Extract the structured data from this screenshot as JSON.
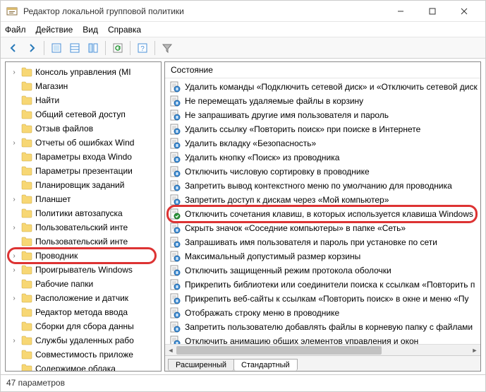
{
  "window": {
    "title": "Редактор локальной групповой политики"
  },
  "menu": {
    "file": "Файл",
    "action": "Действие",
    "view": "Вид",
    "help": "Справка"
  },
  "tree": {
    "items": [
      {
        "label": "Консоль управления (MI",
        "exp": "›"
      },
      {
        "label": "Магазин",
        "exp": ""
      },
      {
        "label": "Найти",
        "exp": ""
      },
      {
        "label": "Общий сетевой доступ",
        "exp": ""
      },
      {
        "label": "Отзыв файлов",
        "exp": ""
      },
      {
        "label": "Отчеты об ошибках Wind",
        "exp": "›"
      },
      {
        "label": "Параметры входа Windo",
        "exp": ""
      },
      {
        "label": "Параметры презентации",
        "exp": ""
      },
      {
        "label": "Планировщик заданий",
        "exp": ""
      },
      {
        "label": "Планшет",
        "exp": "›"
      },
      {
        "label": "Политики автозапуска",
        "exp": ""
      },
      {
        "label": "Пользовательский инте",
        "exp": "›"
      },
      {
        "label": "Пользовательский инте",
        "exp": ""
      },
      {
        "label": "Проводник",
        "exp": "›",
        "hl": true
      },
      {
        "label": "Проигрыватель Windows",
        "exp": "›"
      },
      {
        "label": "Рабочие папки",
        "exp": ""
      },
      {
        "label": "Расположение и датчик",
        "exp": "›"
      },
      {
        "label": "Редактор метода ввода",
        "exp": ""
      },
      {
        "label": "Сборки для сбора данны",
        "exp": ""
      },
      {
        "label": "Службы удаленных рабо",
        "exp": "›"
      },
      {
        "label": "Совместимость приложе",
        "exp": ""
      },
      {
        "label": "Содержимое облака",
        "exp": ""
      }
    ]
  },
  "list": {
    "header": "Состояние",
    "items": [
      {
        "label": "Удалить команды «Подключить сетевой диск» и «Отключить сетевой диск"
      },
      {
        "label": "Не перемещать удаляемые файлы в корзину"
      },
      {
        "label": "Не запрашивать другие имя пользователя и пароль"
      },
      {
        "label": "Удалить ссылку «Повторить поиск» при поиске в Интернете"
      },
      {
        "label": "Удалить вкладку «Безопасность»"
      },
      {
        "label": "Удалить кнопку «Поиск» из проводника"
      },
      {
        "label": "Отключить числовую сортировку в проводнике"
      },
      {
        "label": "Запретить вывод контекстного меню по умолчанию для проводника"
      },
      {
        "label": "Запретить доступ к дискам через «Мой компьютер»"
      },
      {
        "label": "Отключить сочетания клавиш, в которых используется клавиша Windows",
        "hl": true,
        "enabled": true
      },
      {
        "label": "Скрыть значок «Соседние компьютеры» в папке «Сеть»"
      },
      {
        "label": "Запрашивать имя пользователя и пароль при установке по сети"
      },
      {
        "label": "Максимальный допустимый размер корзины"
      },
      {
        "label": "Отключить защищенный режим протокола оболочки"
      },
      {
        "label": "Прикрепить библиотеки или соединители поиска к ссылкам «Повторить п"
      },
      {
        "label": "Прикрепить веб-сайты к ссылкам «Повторить поиск» в окне и меню «Пу"
      },
      {
        "label": "Отображать строку меню в проводнике"
      },
      {
        "label": "Запретить пользователю добавлять файлы в корневую папку с файлами"
      },
      {
        "label": "Отключить анимацию общих элементов управления и окон"
      }
    ]
  },
  "tabs": {
    "extended": "Расширенный",
    "standard": "Стандартный"
  },
  "status": {
    "text": "47 параметров"
  }
}
